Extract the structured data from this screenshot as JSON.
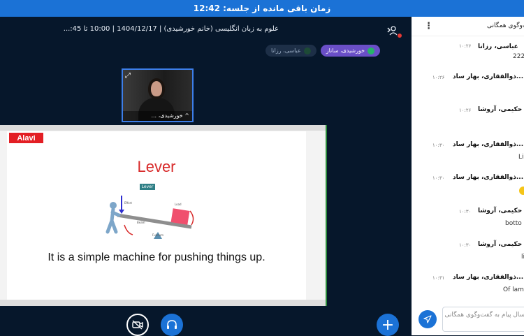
{
  "session": {
    "remaining_time_label": "زمان باقی مانده از جلسه: 12:42"
  },
  "meeting": {
    "title": "علوم به زبان انگلیسی (خانم خورشیدی) | 1404/12/17 | 10:00 تا 45:..."
  },
  "speakers": [
    {
      "name": "خورشیدی، ساناز",
      "active": true
    },
    {
      "name": "عباسی، رزانا",
      "active": false
    }
  ],
  "webcam": {
    "name": "^ خورشیدی، ..."
  },
  "slide": {
    "badge": "Alavi",
    "title": "Lever",
    "tag": "Lever",
    "caption": "It is a simple machine for pushing things up.",
    "diagram_labels": {
      "effort": "Effort",
      "load": "Load",
      "fulcrum": "Fulcrum",
      "beam": "Beam"
    }
  },
  "chat": {
    "title": "گفت‌وگوی همگانی",
    "messages": [
      {
        "name": "عباسی، رزانا",
        "time": "۱۰:۲۶",
        "text": "222"
      },
      {
        "name": "ذوالفقاری، بهار ساد...",
        "time": "۱۰:۲۶",
        "text": ""
      },
      {
        "name": "حکیمی، آروشا",
        "time": "۱۰:۲۶",
        "text": ""
      },
      {
        "name": "ذوالفقاری، بهار ساد...",
        "time": "۱۰:۳۰",
        "text": "Li"
      },
      {
        "name": "ذوالفقاری، بهار ساد...",
        "time": "۱۰:۳۰",
        "text": ""
      },
      {
        "name": "حکیمی، آروشا",
        "time": "۱۰:۳۰",
        "text": "botto"
      },
      {
        "name": "حکیمی، آروشا",
        "time": "۱۰:۳۰",
        "text": "li"
      },
      {
        "name": "ذوالفقاری، بهار ساد...",
        "time": "۱۰:۳۱",
        "text": "Of lam"
      }
    ],
    "input_placeholder": "ارسال پیام به گفت‌وگوی همگانی"
  },
  "colors": {
    "topbar": "#1b72d6",
    "background": "#06172b",
    "active_speaker": "#6a4fc7",
    "slide_red": "#d82b2b"
  }
}
